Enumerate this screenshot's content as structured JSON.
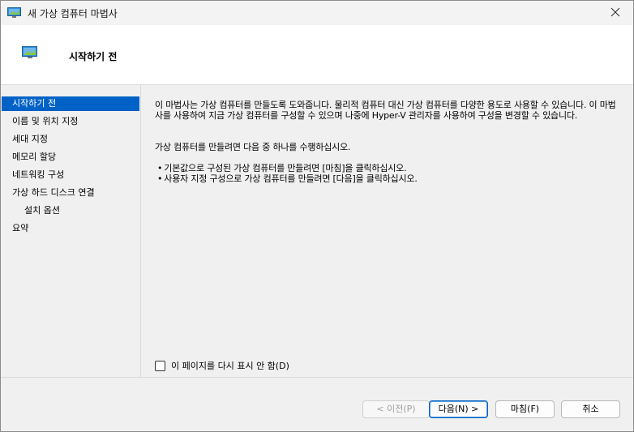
{
  "window": {
    "title": "새 가상 컴퓨터 마법사",
    "close_icon": "close-icon"
  },
  "header": {
    "title": "시작하기 전",
    "icon": "virtual-machine-icon"
  },
  "nav": {
    "items": [
      {
        "label": "시작하기 전",
        "selected": true
      },
      {
        "label": "이름 및 위치 지정"
      },
      {
        "label": "세대 지정"
      },
      {
        "label": "메모리 할당"
      },
      {
        "label": "네트워킹 구성"
      },
      {
        "label": "가상 하드 디스크 연결"
      },
      {
        "label": "설치 옵션",
        "indent": true
      },
      {
        "label": "요약"
      }
    ]
  },
  "content": {
    "para1": "이 마법사는 가상 컴퓨터를 만들도록 도와줍니다. 물리적 컴퓨터 대신 가상 컴퓨터를 다양한 용도로 사용할 수 있습니다. 이 마법사를 사용하여 지금 가상 컴퓨터를 구성할 수 있으며 나중에 Hyper-V 관리자를 사용하여 구성을 변경할 수 있습니다.",
    "para2": "가상 컴퓨터를 만들려면 다음 중 하나를 수행하십시오.",
    "bullets": [
      "기본값으로 구성된 가상 컴퓨터를 만들려면 [마침]을 클릭하십시오.",
      "사용자 지정 구성으로 가상 컴퓨터를 만들려면 [다음]을 클릭하십시오."
    ],
    "checkbox_label": "이 페이지를 다시 표시 안 함(D)",
    "checkbox_checked": false
  },
  "buttons": {
    "prev": "< 이전(P)",
    "next": "다음(N) >",
    "finish": "마침(F)",
    "cancel": "취소"
  },
  "colors": {
    "selection": "#0062c6",
    "icon_blue": "#2f8fdc",
    "icon_green": "#8cc63f"
  }
}
